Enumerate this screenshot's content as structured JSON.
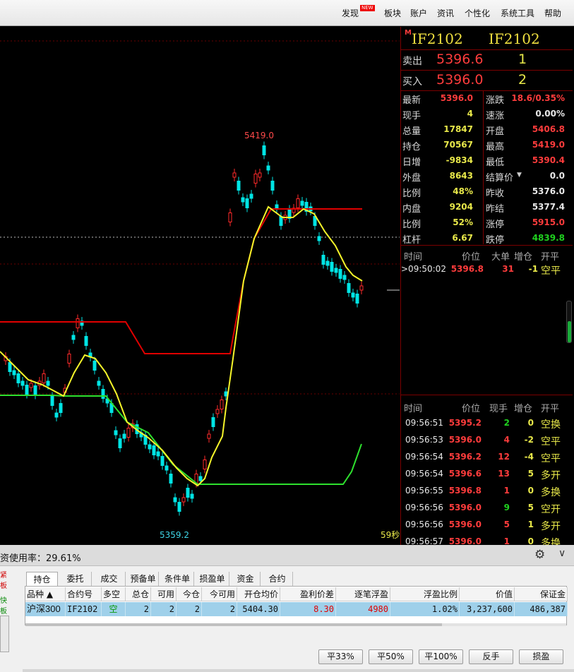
{
  "menu": {
    "discover": "发现",
    "new_badge": "NEW",
    "items": [
      "板块",
      "账户",
      "资讯",
      "个性化",
      "系统工具",
      "帮助"
    ]
  },
  "chart": {
    "high_label": "5419.0",
    "low_label": "5359.2",
    "timer": "59秒",
    "colors": {
      "up": "#ff2a2a",
      "down": "#00e5e5",
      "ma_yellow": "#f5f52a",
      "ma_red": "#e00000",
      "ma_green": "#2ee02e"
    }
  },
  "quote": {
    "marker": "M",
    "code_left": "IF2102",
    "code_right": "IF2102",
    "sell_label": "卖出",
    "sell_price": "5396.6",
    "sell_qty": "1",
    "buy_label": "买入",
    "buy_price": "5396.0",
    "buy_qty": "2",
    "rows": [
      {
        "l1": "最新",
        "v1": "5396.0",
        "c1": "red",
        "l2": "涨跌",
        "v2": "18.6/0.35%",
        "c2": "red"
      },
      {
        "l1": "现手",
        "v1": "4",
        "c1": "yellow",
        "l2": "速涨",
        "v2": "0.00%",
        "c2": "white"
      },
      {
        "l1": "总量",
        "v1": "17847",
        "c1": "yellow",
        "l2": "开盘",
        "v2": "5406.8",
        "c2": "red"
      },
      {
        "l1": "持仓",
        "v1": "70567",
        "c1": "yellow",
        "l2": "最高",
        "v2": "5419.0",
        "c2": "red"
      },
      {
        "l1": "日增",
        "v1": "-9834",
        "c1": "yellow",
        "l2": "最低",
        "v2": "5390.4",
        "c2": "red"
      },
      {
        "l1": "外盘",
        "v1": "8643",
        "c1": "yellow",
        "l2": "结算价",
        "v2": "0.0",
        "c2": "white"
      },
      {
        "l1": "比例",
        "v1": "48%",
        "c1": "yellow",
        "l2": "昨收",
        "v2": "5376.0",
        "c2": "white"
      },
      {
        "l1": "内盘",
        "v1": "9204",
        "c1": "yellow",
        "l2": "昨结",
        "v2": "5377.4",
        "c2": "white"
      },
      {
        "l1": "比例",
        "v1": "52%",
        "c1": "yellow",
        "l2": "涨停",
        "v2": "5915.0",
        "c2": "red"
      },
      {
        "l1": "杠杆",
        "v1": "6.67",
        "c1": "yellow",
        "l2": "跌停",
        "v2": "4839.8",
        "c2": "green"
      }
    ],
    "big_header": [
      "时间",
      "价位",
      "大单",
      "增仓",
      "开平"
    ],
    "big_row": {
      "time": ">09:50:02",
      "price": "5396.8",
      "big": "31",
      "inc": "-1",
      "type": "空平"
    },
    "tick_header": [
      "时间",
      "价位",
      "现手",
      "增仓",
      "开平"
    ],
    "ticks": [
      {
        "time": "09:56:51",
        "price": "5395.2",
        "qty": "2",
        "qc": "green",
        "inc": "0",
        "type": "空换"
      },
      {
        "time": "09:56:53",
        "price": "5396.0",
        "qty": "4",
        "qc": "red",
        "inc": "-2",
        "type": "空平"
      },
      {
        "time": "09:56:54",
        "price": "5396.2",
        "qty": "12",
        "qc": "red",
        "inc": "-4",
        "type": "空平"
      },
      {
        "time": "09:56:54",
        "price": "5396.6",
        "qty": "13",
        "qc": "red",
        "inc": "5",
        "type": "多开"
      },
      {
        "time": "09:56:55",
        "price": "5396.8",
        "qty": "1",
        "qc": "red",
        "inc": "0",
        "type": "多换"
      },
      {
        "time": "09:56:56",
        "price": "5396.0",
        "qty": "9",
        "qc": "green",
        "inc": "5",
        "type": "空开"
      },
      {
        "time": "09:56:56",
        "price": "5396.0",
        "qty": "5",
        "qc": "red",
        "inc": "1",
        "type": "多开"
      },
      {
        "time": "09:56:57",
        "price": "5396.0",
        "qty": "1",
        "qc": "red",
        "inc": "0",
        "type": "多换"
      }
    ]
  },
  "bottom": {
    "usage": "资使用率：29.61%",
    "side_labels": [
      "紧板",
      "快板"
    ],
    "tabs": [
      "持仓",
      "委托",
      "成交",
      "预备单",
      "条件单",
      "损盈单",
      "资金",
      "合约"
    ],
    "columns": [
      "品种 ▲",
      "合约号",
      "多空",
      "总仓",
      "可用",
      "今仓",
      "今可用",
      "开仓均价",
      "盈利价差",
      "逐笔浮盈",
      "浮盈比例",
      "价值",
      "保证金"
    ],
    "row": [
      "沪深300",
      "IF2102",
      "空",
      "2",
      "2",
      "2",
      "2",
      "5404.30",
      "8.30",
      "4980",
      "1.02%",
      "3,237,600",
      "486,387"
    ],
    "buttons": [
      "平33%",
      "平50%",
      "平100%",
      "反手",
      "损盈"
    ]
  }
}
